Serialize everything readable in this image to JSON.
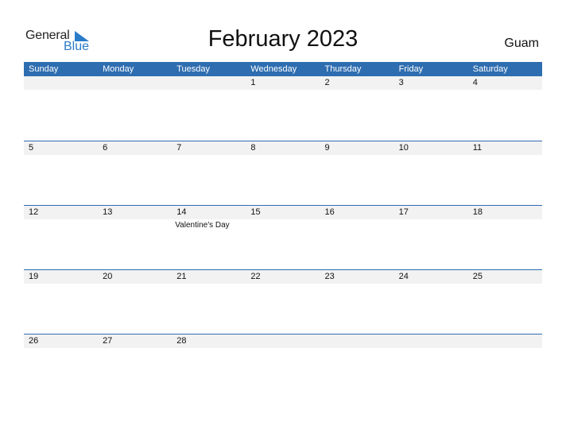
{
  "logo": {
    "line1": "General",
    "line2": "Blue",
    "accent": "#2b7bc9"
  },
  "title": "February 2023",
  "country": "Guam",
  "colors": {
    "header_bg": "#2e6db0",
    "daynum_bg": "#f2f2f2"
  },
  "weekdays": [
    "Sunday",
    "Monday",
    "Tuesday",
    "Wednesday",
    "Thursday",
    "Friday",
    "Saturday"
  ],
  "weeks": [
    {
      "days": [
        "",
        "",
        "",
        "1",
        "2",
        "3",
        "4"
      ],
      "events": [
        "",
        "",
        "",
        "",
        "",
        "",
        ""
      ]
    },
    {
      "days": [
        "5",
        "6",
        "7",
        "8",
        "9",
        "10",
        "11"
      ],
      "events": [
        "",
        "",
        "",
        "",
        "",
        "",
        ""
      ]
    },
    {
      "days": [
        "12",
        "13",
        "14",
        "15",
        "16",
        "17",
        "18"
      ],
      "events": [
        "",
        "",
        "Valentine's Day",
        "",
        "",
        "",
        ""
      ]
    },
    {
      "days": [
        "19",
        "20",
        "21",
        "22",
        "23",
        "24",
        "25"
      ],
      "events": [
        "",
        "",
        "",
        "",
        "",
        "",
        ""
      ]
    },
    {
      "days": [
        "26",
        "27",
        "28",
        "",
        "",
        "",
        ""
      ],
      "events": [
        "",
        "",
        "",
        "",
        "",
        "",
        ""
      ]
    }
  ]
}
